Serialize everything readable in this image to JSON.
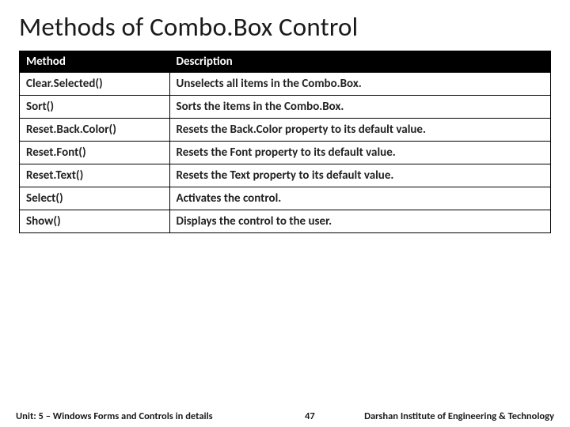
{
  "title": "Methods of Combo.Box Control",
  "table": {
    "headers": {
      "method": "Method",
      "description": "Description"
    },
    "rows": [
      {
        "method": "Clear.Selected()",
        "description": "Unselects all items in the Combo.Box."
      },
      {
        "method": "Sort()",
        "description": "Sorts the items in the Combo.Box."
      },
      {
        "method": "Reset.Back.Color()",
        "description": "Resets the Back.Color property to its default value."
      },
      {
        "method": "Reset.Font()",
        "description": "Resets the Font property to its default value."
      },
      {
        "method": "Reset.Text()",
        "description": "Resets the Text property to its default value."
      },
      {
        "method": "Select()",
        "description": "Activates the control."
      },
      {
        "method": "Show()",
        "description": "Displays the control to the user."
      }
    ]
  },
  "footer": {
    "unit": "Unit: 5 – Windows Forms and Controls in details",
    "page": "47",
    "institute": "Darshan Institute of Engineering & Technology"
  }
}
